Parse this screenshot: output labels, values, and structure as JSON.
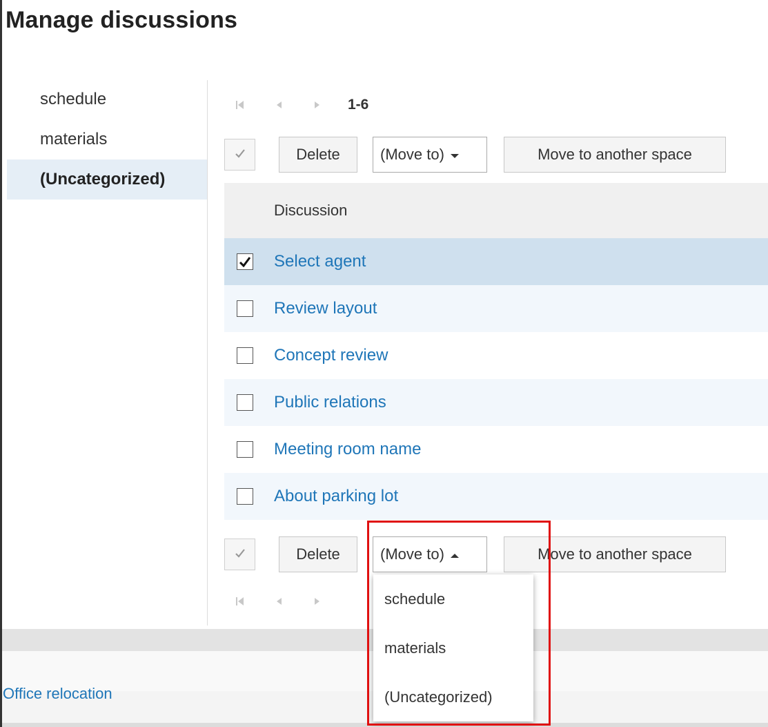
{
  "page": {
    "title": "Manage discussions"
  },
  "sidebar": {
    "items": [
      {
        "label": "schedule",
        "selected": false
      },
      {
        "label": "materials",
        "selected": false
      },
      {
        "label": "(Uncategorized)",
        "selected": true
      }
    ]
  },
  "pager": {
    "range": "1-6"
  },
  "toolbar": {
    "delete_label": "Delete",
    "move_to_label": "(Move to)",
    "move_space_label": "Move to another space"
  },
  "table": {
    "column_header": "Discussion",
    "rows": [
      {
        "title": "Select agent",
        "checked": true
      },
      {
        "title": "Review layout",
        "checked": false
      },
      {
        "title": "Concept review",
        "checked": false
      },
      {
        "title": "Public relations",
        "checked": false
      },
      {
        "title": "Meeting room name",
        "checked": false
      },
      {
        "title": "About parking lot",
        "checked": false
      }
    ]
  },
  "dropdown": {
    "open": true,
    "options": [
      "schedule",
      "materials",
      "(Uncategorized)"
    ]
  },
  "footer": {
    "link_label": "Office relocation"
  },
  "colors": {
    "link": "#1f76b8",
    "selected_row": "#cfe0ee",
    "highlight": "#e01010"
  }
}
